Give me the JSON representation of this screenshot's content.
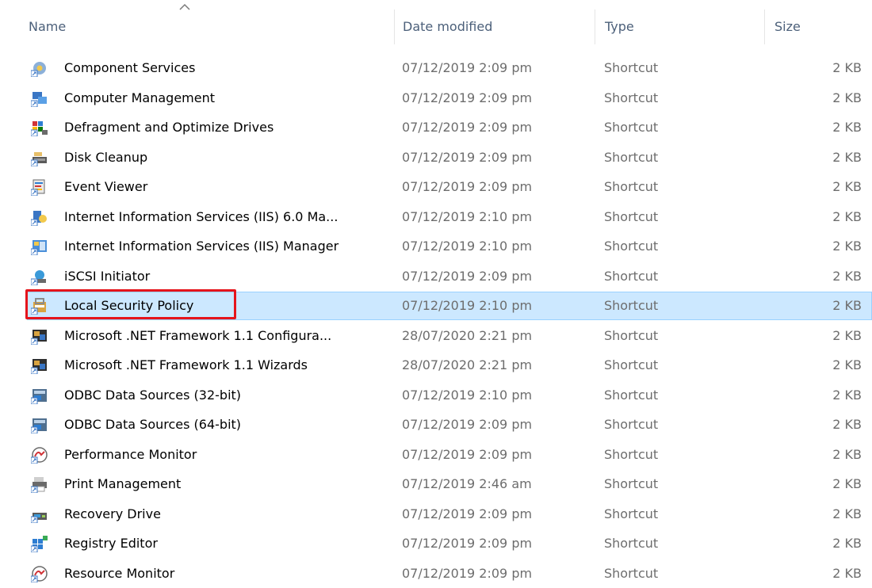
{
  "columns": {
    "name": "Name",
    "date": "Date modified",
    "type": "Type",
    "size": "Size"
  },
  "sort_indicator": "sort-ascending-chevron-icon",
  "selected_row_index": 8,
  "highlight_row_index": 8,
  "highlight_color": "#e5141b",
  "selection_color": "#cce8ff",
  "rows": [
    {
      "name": "Component Services",
      "date": "07/12/2019 2:09 pm",
      "type": "Shortcut",
      "size": "2 KB",
      "icon": "component-services-icon"
    },
    {
      "name": "Computer Management",
      "date": "07/12/2019 2:09 pm",
      "type": "Shortcut",
      "size": "2 KB",
      "icon": "computer-management-icon"
    },
    {
      "name": "Defragment and Optimize Drives",
      "date": "07/12/2019 2:09 pm",
      "type": "Shortcut",
      "size": "2 KB",
      "icon": "defragment-icon"
    },
    {
      "name": "Disk Cleanup",
      "date": "07/12/2019 2:09 pm",
      "type": "Shortcut",
      "size": "2 KB",
      "icon": "disk-cleanup-icon"
    },
    {
      "name": "Event Viewer",
      "date": "07/12/2019 2:09 pm",
      "type": "Shortcut",
      "size": "2 KB",
      "icon": "event-viewer-icon"
    },
    {
      "name": "Internet Information Services (IIS) 6.0 Ma...",
      "date": "07/12/2019 2:10 pm",
      "type": "Shortcut",
      "size": "2 KB",
      "icon": "iis6-manager-icon"
    },
    {
      "name": "Internet Information Services (IIS) Manager",
      "date": "07/12/2019 2:10 pm",
      "type": "Shortcut",
      "size": "2 KB",
      "icon": "iis-manager-icon"
    },
    {
      "name": "iSCSI Initiator",
      "date": "07/12/2019 2:09 pm",
      "type": "Shortcut",
      "size": "2 KB",
      "icon": "iscsi-initiator-icon"
    },
    {
      "name": "Local Security Policy",
      "date": "07/12/2019 2:10 pm",
      "type": "Shortcut",
      "size": "2 KB",
      "icon": "local-security-policy-icon"
    },
    {
      "name": "Microsoft .NET Framework 1.1 Configura...",
      "date": "28/07/2020 2:21 pm",
      "type": "Shortcut",
      "size": "2 KB",
      "icon": "dotnet-configuration-icon"
    },
    {
      "name": "Microsoft .NET Framework 1.1 Wizards",
      "date": "28/07/2020 2:21 pm",
      "type": "Shortcut",
      "size": "2 KB",
      "icon": "dotnet-wizards-icon"
    },
    {
      "name": "ODBC Data Sources (32-bit)",
      "date": "07/12/2019 2:10 pm",
      "type": "Shortcut",
      "size": "2 KB",
      "icon": "odbc-32-icon"
    },
    {
      "name": "ODBC Data Sources (64-bit)",
      "date": "07/12/2019 2:09 pm",
      "type": "Shortcut",
      "size": "2 KB",
      "icon": "odbc-64-icon"
    },
    {
      "name": "Performance Monitor",
      "date": "07/12/2019 2:09 pm",
      "type": "Shortcut",
      "size": "2 KB",
      "icon": "performance-monitor-icon"
    },
    {
      "name": "Print Management",
      "date": "07/12/2019 2:46 am",
      "type": "Shortcut",
      "size": "2 KB",
      "icon": "print-management-icon"
    },
    {
      "name": "Recovery Drive",
      "date": "07/12/2019 2:09 pm",
      "type": "Shortcut",
      "size": "2 KB",
      "icon": "recovery-drive-icon"
    },
    {
      "name": "Registry Editor",
      "date": "07/12/2019 2:09 pm",
      "type": "Shortcut",
      "size": "2 KB",
      "icon": "registry-editor-icon"
    },
    {
      "name": "Resource Monitor",
      "date": "07/12/2019 2:09 pm",
      "type": "Shortcut",
      "size": "2 KB",
      "icon": "resource-monitor-icon"
    }
  ]
}
